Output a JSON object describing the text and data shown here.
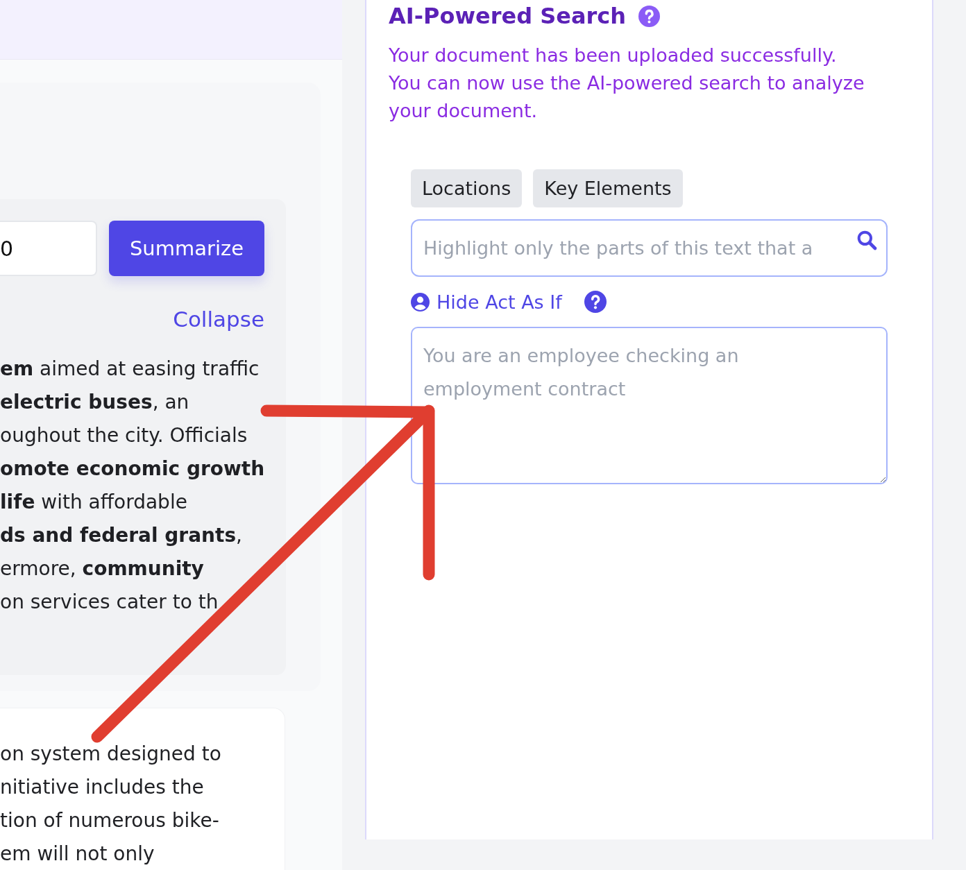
{
  "left_panel": {
    "count_field": {
      "value": "0"
    },
    "summarize_button": "Summarize",
    "collapse_link": "Collapse",
    "summary_lines": [
      "**em** aimed at easing traffic",
      "**electric buses**, an",
      "oughout the city. Officials",
      "**omote economic growth**",
      "**life** with affordable",
      "**ds and federal grants**,",
      "ermore, **community**",
      "on services cater to th"
    ],
    "next_card_lines": [
      "on system designed to",
      "nitiative includes the",
      "tion of numerous bike-",
      "em will not only"
    ]
  },
  "search_panel": {
    "title": "AI-Powered Search",
    "description": "Your document has been uploaded successfully. You can now use the AI-powered search to analyze your document.",
    "quick_filters": [
      "Locations",
      "Key Elements"
    ],
    "search": {
      "placeholder": "Highlight only the parts of this text that a"
    },
    "act_as_toggle": "Hide Act As If",
    "act_as": {
      "placeholder": "You are an employee checking an employment contract"
    }
  },
  "annotation": {
    "kind": "arrow"
  }
}
